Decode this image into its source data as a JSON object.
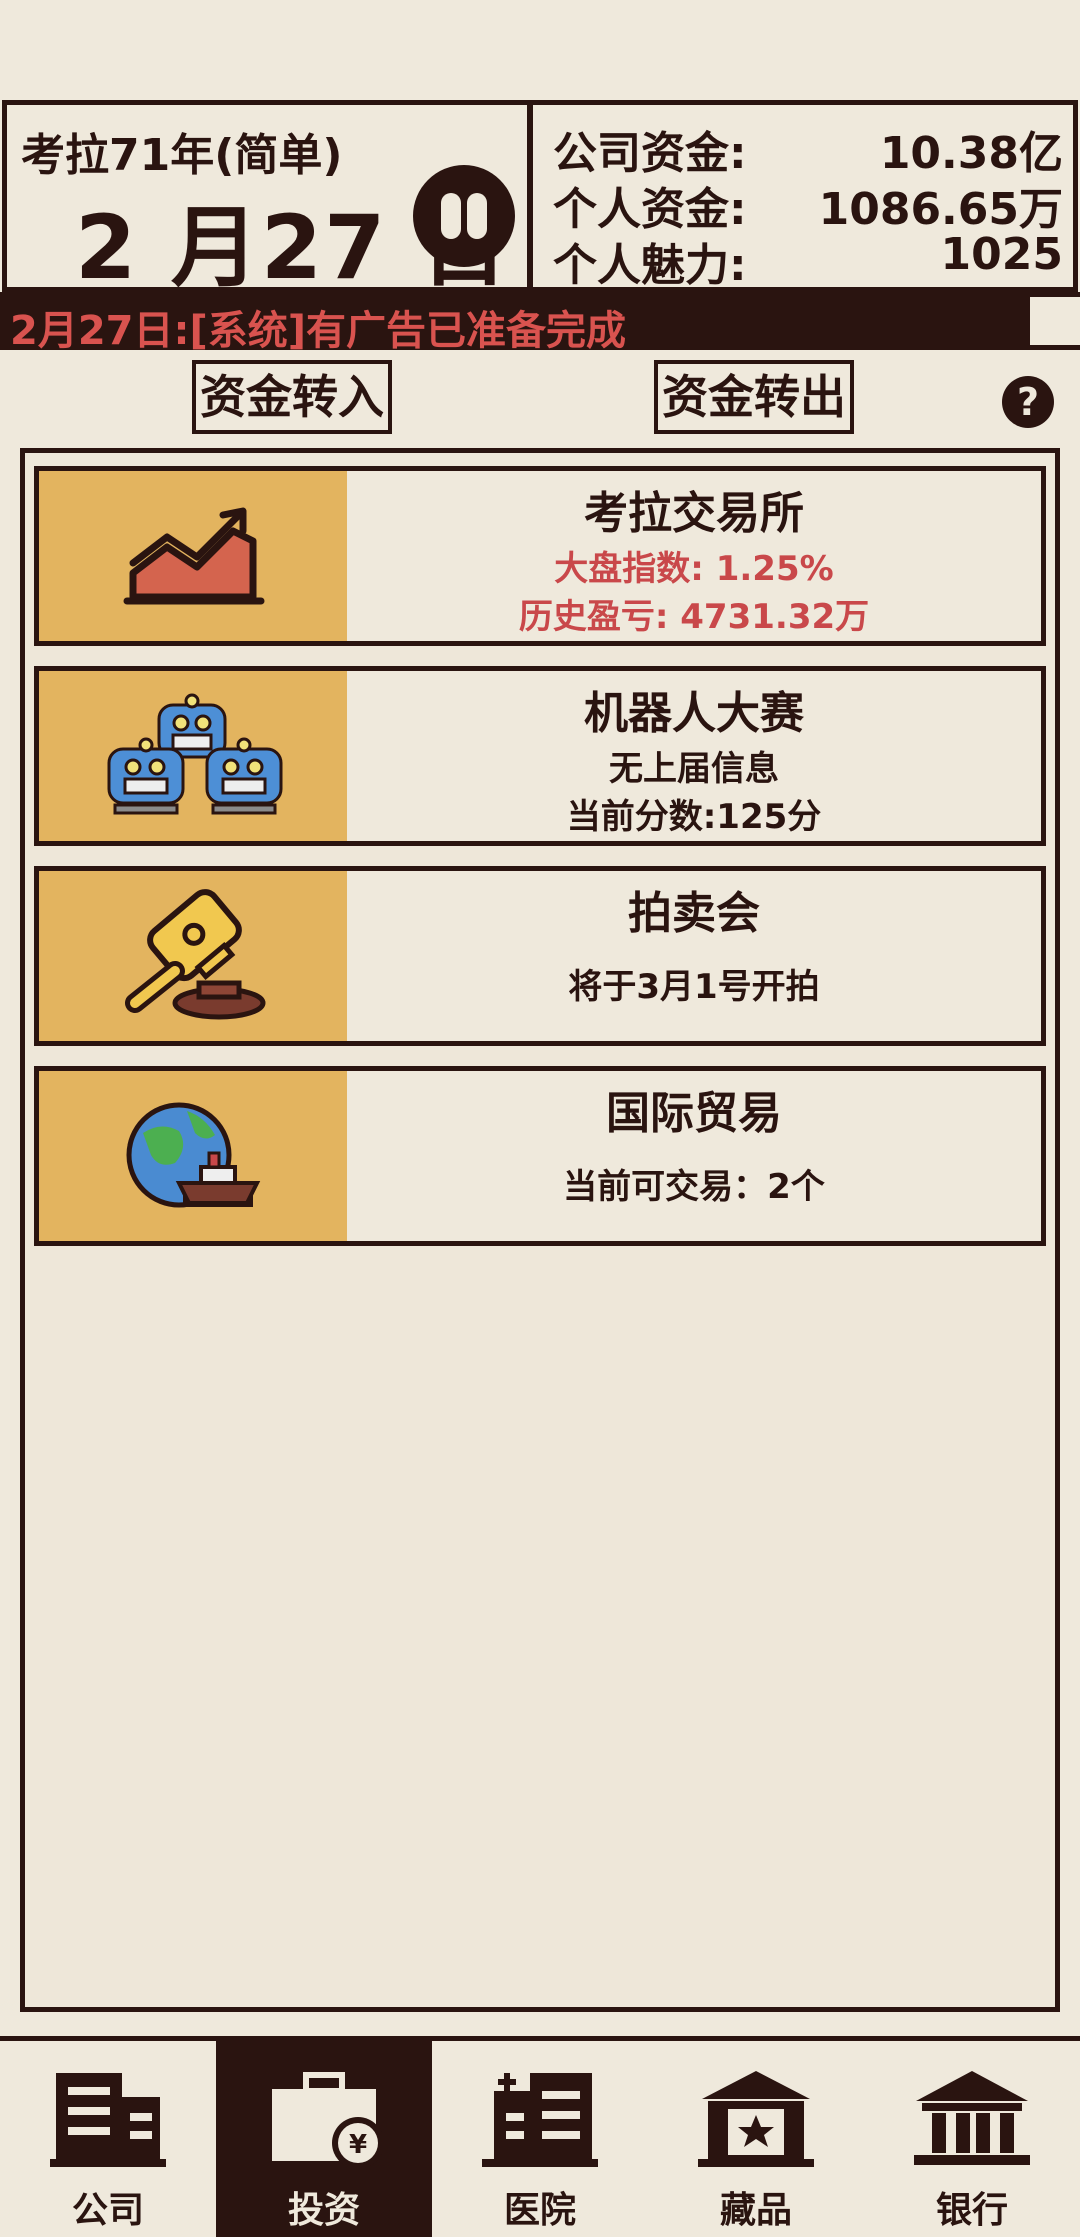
{
  "header": {
    "year": "考拉71年(简单)",
    "date": "2 月27 日",
    "funds": [
      {
        "label": "公司资金:",
        "value": "10.38亿"
      },
      {
        "label": "个人资金:",
        "value": "1086.65万"
      },
      {
        "label": "个人魅力:",
        "value": "1025"
      }
    ]
  },
  "ticker": {
    "text": "2月27日:[系统]有广告已准备完成"
  },
  "actions": {
    "transfer_in": "资金转入",
    "transfer_out": "资金转出",
    "help": "?"
  },
  "cards": [
    {
      "title": "考拉交易所",
      "line1": "大盘指数: 1.25%",
      "line2": "历史盈亏: 4731.32万",
      "icon": "stock-chart-icon"
    },
    {
      "title": "机器人大赛",
      "line1": "无上届信息",
      "line2": "当前分数:125分",
      "icon": "robots-icon"
    },
    {
      "title": "拍卖会",
      "line1": "将于3月1号开拍",
      "icon": "gavel-icon"
    },
    {
      "title": "国际贸易",
      "line1": "当前可交易：2个",
      "icon": "globe-ship-icon"
    }
  ],
  "nav": {
    "items": [
      {
        "label": "公司",
        "icon": "building-icon"
      },
      {
        "label": "投资",
        "icon": "briefcase-yen-icon"
      },
      {
        "label": "医院",
        "icon": "hospital-icon"
      },
      {
        "label": "藏品",
        "icon": "museum-star-icon"
      },
      {
        "label": "银行",
        "icon": "bank-icon"
      }
    ],
    "active": "投资"
  },
  "colors": {
    "dark": "#2a1410",
    "background": "#efe9dc",
    "thumb": "#e3b45f",
    "accent_red": "#c9484a"
  }
}
